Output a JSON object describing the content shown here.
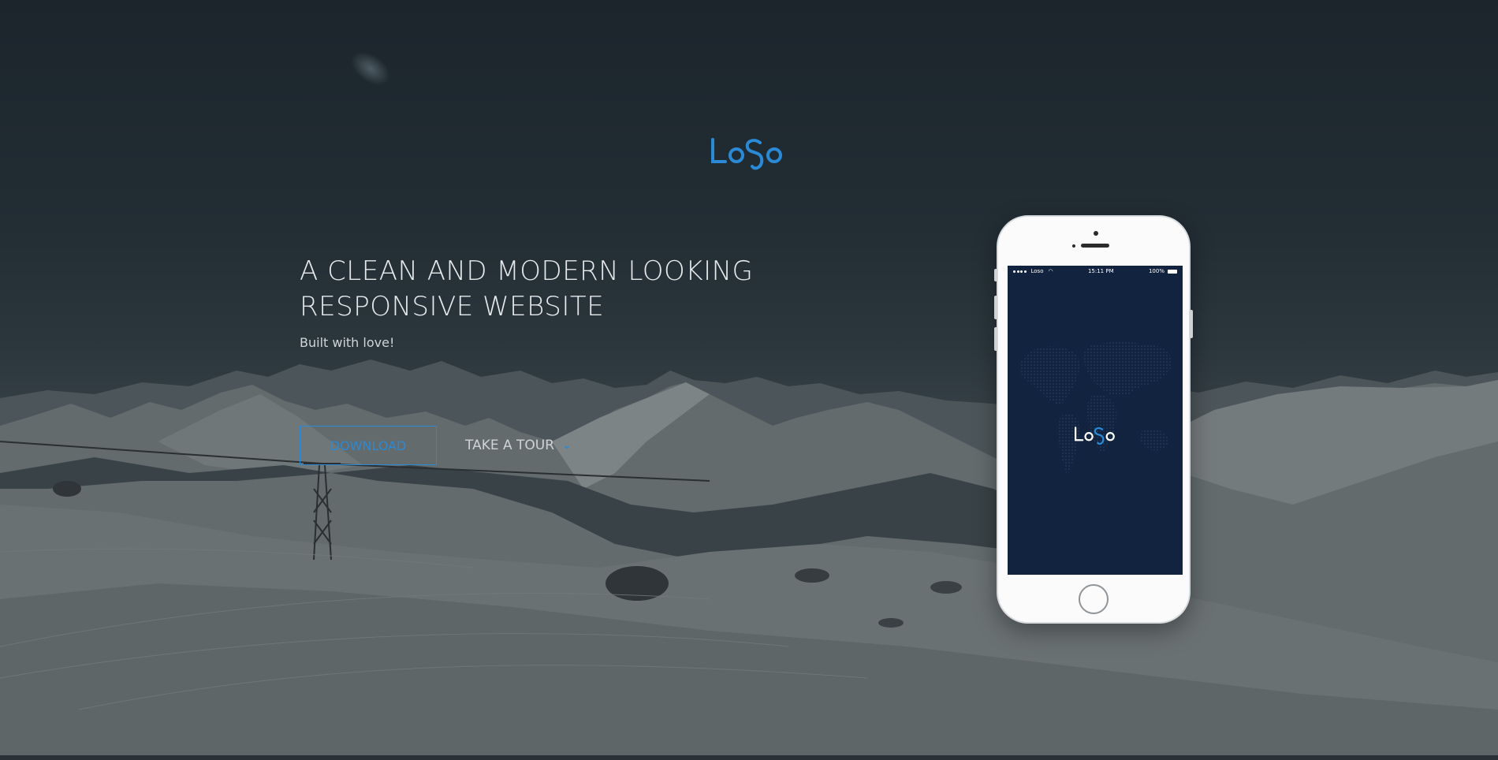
{
  "brand": {
    "logo_text": "LoSo",
    "logo_color": "#2a8ad6"
  },
  "hero": {
    "headline_line1": "A CLEAN AND MODERN LOOKING",
    "headline_line2": "RESPONSIVE WEBSITE",
    "subline": "Built with love!",
    "download_label": "DOWNLOAD",
    "tour_label": "TAKE A TOUR",
    "tour_icon": "chevron-down-icon"
  },
  "phone": {
    "status": {
      "carrier": "Loso",
      "time": "15:11 PM",
      "battery": "100%"
    },
    "app_logo_text": "LoSo"
  },
  "colors": {
    "accent": "#2a8ad6",
    "screen_bg": "#11233f",
    "text_light": "#e6eaec"
  }
}
